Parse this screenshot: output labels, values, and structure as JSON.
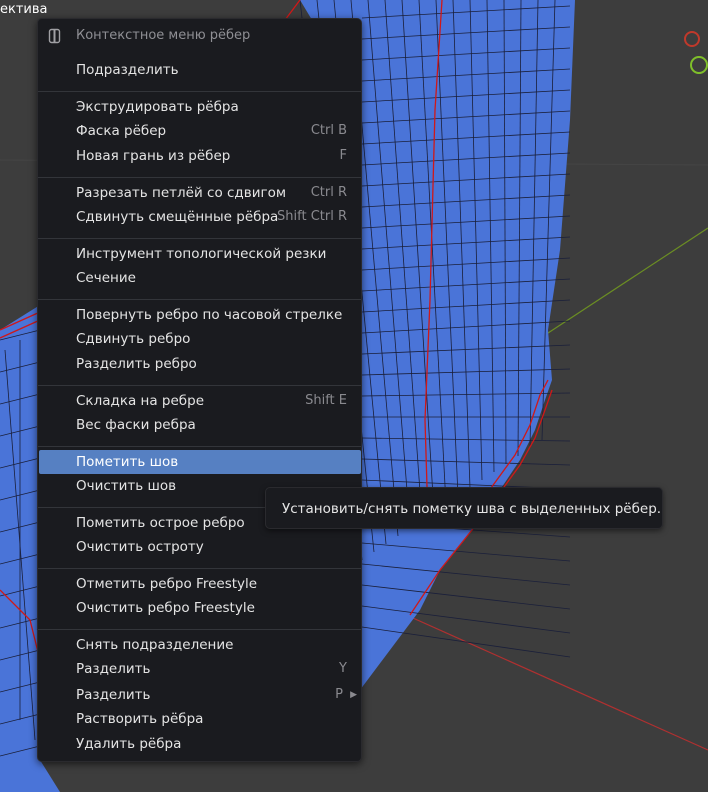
{
  "viewport": {
    "view_label": "ектива"
  },
  "colors": {
    "mesh_fill": "#4a74d8",
    "mesh_edge": "#1a1f3a",
    "seam_edge": "#d01818",
    "background": "#3d3d3d",
    "axis_x": "#c0392b",
    "axis_y": "#7fbf2a",
    "menu_bg": "#1a1b1f",
    "highlight": "#5680c2"
  },
  "menu": {
    "title_icon": "edge-menu-icon",
    "title": "Контекстное меню рёбер",
    "items": [
      {
        "label": "Подразделить",
        "shortcut": ""
      },
      {
        "label": "Экструдировать рёбра",
        "shortcut": ""
      },
      {
        "label": "Фаска рёбер",
        "shortcut": "Ctrl B"
      },
      {
        "label": "Новая грань из рёбер",
        "shortcut": "F"
      },
      {
        "label": "Разрезать петлёй со сдвигом",
        "shortcut": "Ctrl R"
      },
      {
        "label": "Сдвинуть смещённые рёбра",
        "shortcut": "Shift Ctrl R"
      },
      {
        "label": "Инструмент топологической резки",
        "shortcut": ""
      },
      {
        "label": "Сечение",
        "shortcut": ""
      },
      {
        "label": "Повернуть ребро по часовой стрелке",
        "shortcut": ""
      },
      {
        "label": "Сдвинуть ребро",
        "shortcut": ""
      },
      {
        "label": "Разделить ребро",
        "shortcut": ""
      },
      {
        "label": "Складка на ребре",
        "shortcut": "Shift E"
      },
      {
        "label": "Вес фаски ребра",
        "shortcut": ""
      },
      {
        "label": "Пометить шов",
        "shortcut": ""
      },
      {
        "label": "Очистить шов",
        "shortcut": ""
      },
      {
        "label": "Пометить острое ребро",
        "shortcut": ""
      },
      {
        "label": "Очистить остроту",
        "shortcut": ""
      },
      {
        "label": "Отметить ребро Freestyle",
        "shortcut": ""
      },
      {
        "label": "Очистить ребро Freestyle",
        "shortcut": ""
      },
      {
        "label": "Снять подразделение",
        "shortcut": ""
      },
      {
        "label": "Разделить",
        "shortcut": "Y"
      },
      {
        "label": "Разделить",
        "shortcut": "P",
        "submenu_icon": "chevron-right-icon"
      },
      {
        "label": "Растворить рёбра",
        "shortcut": ""
      },
      {
        "label": "Удалить рёбра",
        "shortcut": ""
      }
    ]
  },
  "tooltip": {
    "text": "Установить/снять пометку шва с выделенных рёбер."
  }
}
